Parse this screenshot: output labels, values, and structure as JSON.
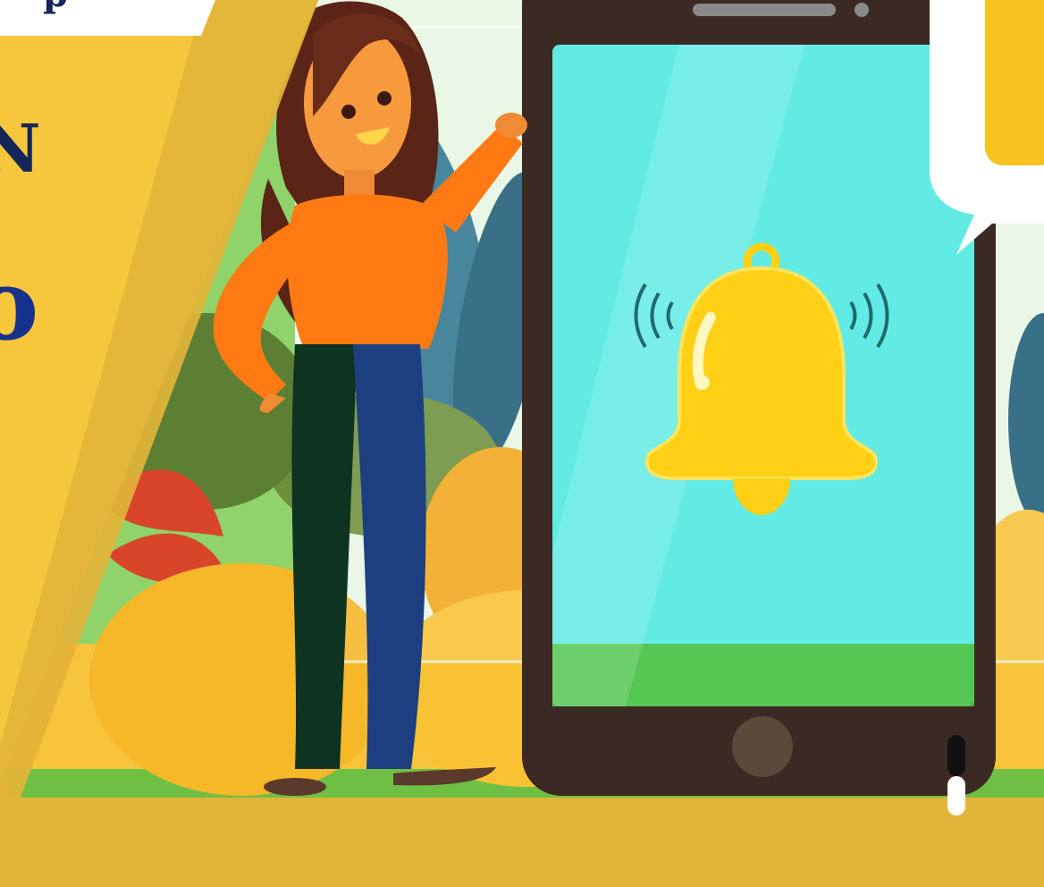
{
  "banner": {
    "headline_fragments": [
      "p",
      "N",
      "o"
    ]
  },
  "illustration": {
    "subject": "woman-pointing-at-phone",
    "phone_screen_icon": "bell-icon",
    "colors": {
      "background_gold": "#e2b43a",
      "panel_yellow": "#f6c63c",
      "phone_screen": "#62ebe4",
      "phone_frame": "#3b2a23",
      "bell": "#ffd016",
      "shirt": "#ff7a12",
      "pants_dark": "#0f3321",
      "pants_blue": "#1d3f80",
      "headline_navy": "#14265a"
    }
  }
}
